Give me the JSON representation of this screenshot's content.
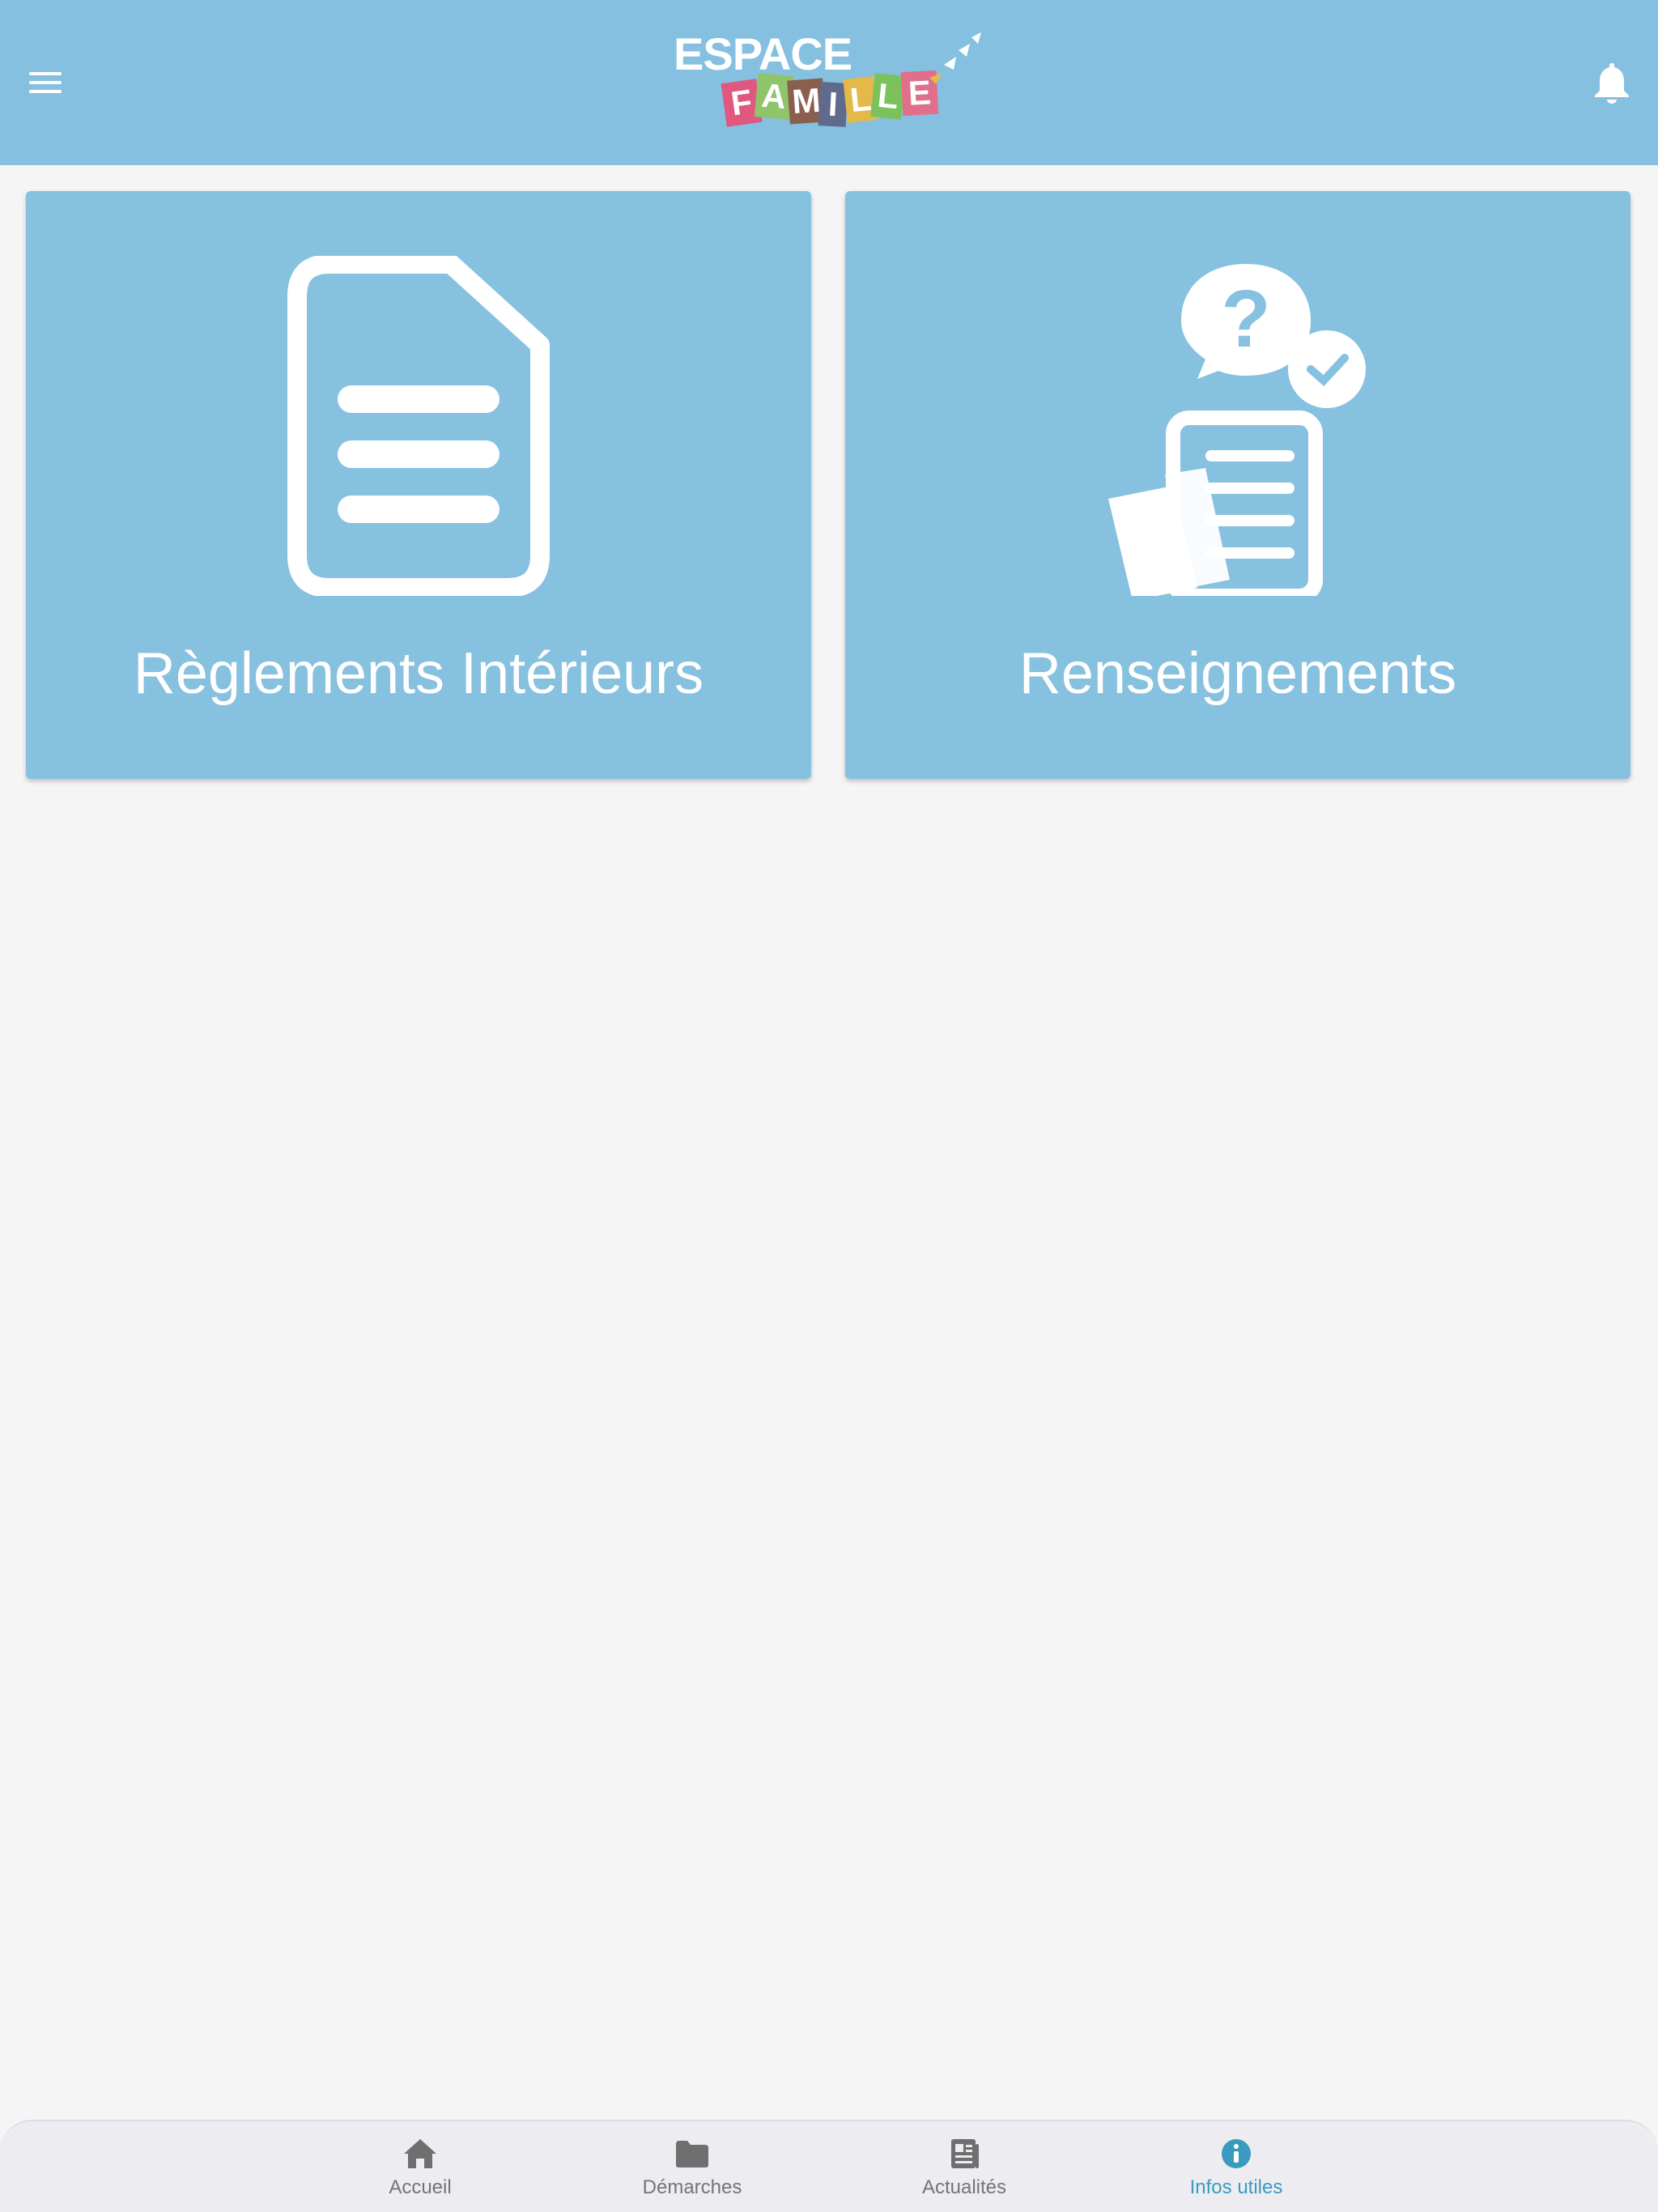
{
  "header": {
    "logo": {
      "line1": "ESPACE",
      "line2_letters": [
        "F",
        "A",
        "M",
        "I",
        "L",
        "L",
        "E"
      ]
    },
    "menu_icon": "hamburger-menu-icon",
    "notification_icon": "bell-icon"
  },
  "cards": [
    {
      "title": "Règlements Intérieurs",
      "icon": "document-icon"
    },
    {
      "title": "Renseignements",
      "icon": "documents-question-icon"
    }
  ],
  "tabbar": {
    "active": "Infos utiles",
    "tabs": [
      {
        "label": "Accueil",
        "icon": "home-icon"
      },
      {
        "label": "Démarches",
        "icon": "folder-icon"
      },
      {
        "label": "Actualités",
        "icon": "newspaper-icon"
      },
      {
        "label": "Infos utiles",
        "icon": "info-icon"
      }
    ]
  },
  "colors": {
    "header_bg": "#85c0e0",
    "card_bg": "#87c1e0",
    "page_bg": "#f5f5f6",
    "tab_inactive": "#757575",
    "tab_active": "#3a9bc0",
    "logo_letters": [
      "#e0577f",
      "#8fc46a",
      "#8a5f4e",
      "#5f6a8c",
      "#e3b94a",
      "#7cc25c",
      "#e06f8c"
    ]
  }
}
